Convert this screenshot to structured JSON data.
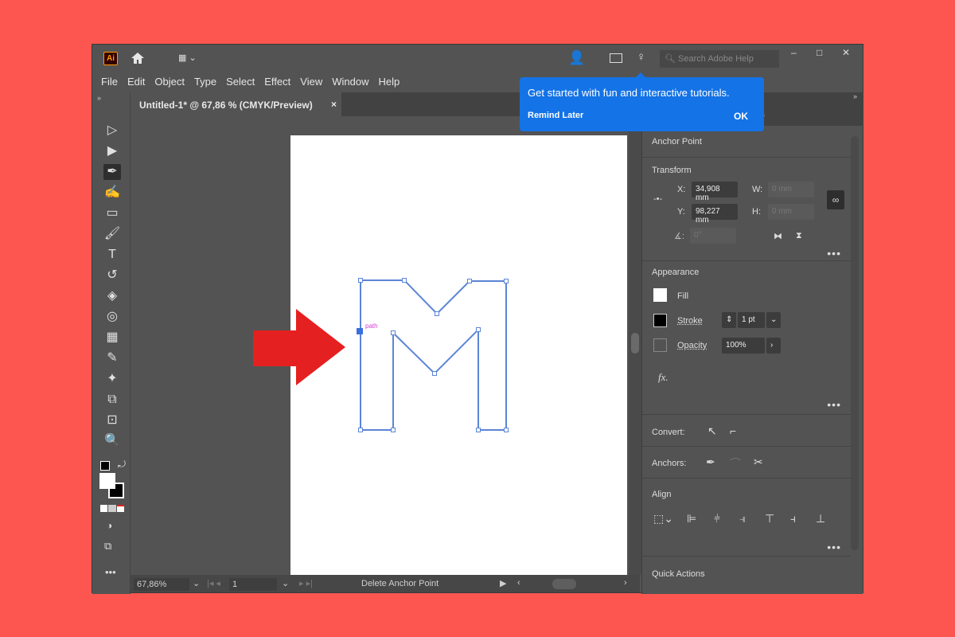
{
  "app": {
    "logo": "Ai",
    "title": "Adobe Illustrator"
  },
  "titlebar": {
    "search_placeholder": "Search Adobe Help",
    "icons": [
      "home-icon",
      "workspace-icon",
      "share-user-icon",
      "panel-icon",
      "lightbulb-icon"
    ],
    "window_controls": {
      "minimize": "–",
      "maximize": "□",
      "close": "✕"
    }
  },
  "menu": [
    "File",
    "Edit",
    "Object",
    "Type",
    "Select",
    "Effect",
    "View",
    "Window",
    "Help"
  ],
  "document_tab": {
    "title": "Untitled-1* @ 67,86 % (CMYK/Preview)",
    "close": "×"
  },
  "tooltip": {
    "message": "Get started with fun and interactive tutorials.",
    "remind_later": "Remind Later",
    "ok": "OK"
  },
  "tools": [
    {
      "name": "selection-tool",
      "glyph": "▷"
    },
    {
      "name": "direct-selection-tool",
      "glyph": "▶"
    },
    {
      "name": "pen-tool",
      "glyph": "✒",
      "active": true
    },
    {
      "name": "curvature-tool",
      "glyph": "✍"
    },
    {
      "name": "rectangle-tool",
      "glyph": "▭"
    },
    {
      "name": "paintbrush-tool",
      "glyph": "🖌"
    },
    {
      "name": "type-tool",
      "glyph": "T"
    },
    {
      "name": "rotate-tool",
      "glyph": "↺"
    },
    {
      "name": "eraser-tool",
      "glyph": "◈"
    },
    {
      "name": "lasso-tool",
      "glyph": "◎"
    },
    {
      "name": "gradient-tool",
      "glyph": "▦"
    },
    {
      "name": "eyedropper-tool",
      "glyph": "✎"
    },
    {
      "name": "puppet-warp-tool",
      "glyph": "✦"
    },
    {
      "name": "shape-builder-tool",
      "glyph": "⧉"
    },
    {
      "name": "artboard-tool",
      "glyph": "⊡"
    },
    {
      "name": "zoom-tool",
      "glyph": "🔍"
    }
  ],
  "canvas": {
    "selection_label": "path"
  },
  "statusbar": {
    "zoom": "67,86%",
    "page": "1",
    "message": "Delete Anchor Point"
  },
  "properties": {
    "tab_partial": "aries",
    "anchor_point_title": "Anchor Point",
    "transform": {
      "title": "Transform",
      "x_label": "X:",
      "x_value": "34,908 mm",
      "y_label": "Y:",
      "y_value": "98,227 mm",
      "w_label": "W:",
      "w_value": "0 mm",
      "h_label": "H:",
      "h_value": "0 mm",
      "angle_value": "0°"
    },
    "appearance": {
      "title": "Appearance",
      "fill_label": "Fill",
      "stroke_label": "Stroke",
      "stroke_value": "1 pt",
      "opacity_label": "Opacity",
      "opacity_value": "100%",
      "fx_label": "fx."
    },
    "convert_label": "Convert:",
    "anchors_label": "Anchors:",
    "align_title": "Align",
    "quick_actions_title": "Quick Actions"
  },
  "colors": {
    "background": "#fd5650",
    "ui": "#535353",
    "accent": "#1473e6",
    "path": "#5b85d6",
    "label": "#d63cd6",
    "arrow": "#e52020"
  }
}
